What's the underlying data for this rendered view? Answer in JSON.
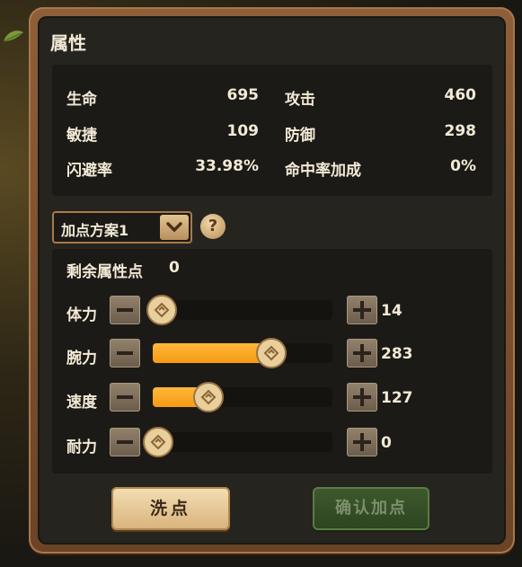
{
  "panel": {
    "title": "属性"
  },
  "stats": [
    {
      "label": "生命",
      "value": "695"
    },
    {
      "label": "攻击",
      "value": "460"
    },
    {
      "label": "敏捷",
      "value": "109"
    },
    {
      "label": "防御",
      "value": "298"
    },
    {
      "label": "闪避率",
      "value": "33.98%"
    },
    {
      "label": "命中率加成",
      "value": "0%"
    }
  ],
  "preset": {
    "selected": "加点方案1",
    "help": "?"
  },
  "allocation": {
    "remaining_label": "剩余属性点",
    "remaining_value": "0",
    "rows": [
      {
        "label": "体力",
        "value": "14",
        "fill_pct": 0
      },
      {
        "label": "腕力",
        "value": "283",
        "fill_pct": 65
      },
      {
        "label": "速度",
        "value": "127",
        "fill_pct": 31
      },
      {
        "label": "耐力",
        "value": "0",
        "fill_pct": 0
      }
    ]
  },
  "buttons": {
    "reset": "洗点",
    "confirm": "确认加点"
  },
  "colors": {
    "accent_fill": "#f5a623",
    "panel_frame": "#7a5030",
    "confirm_green": "#3a5229"
  }
}
